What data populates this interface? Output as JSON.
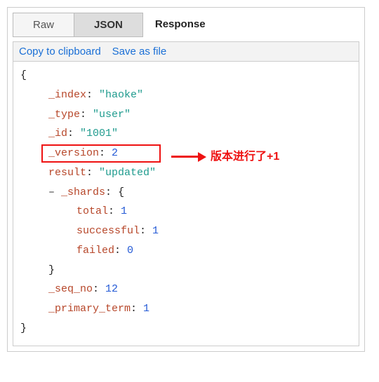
{
  "tabs": {
    "raw": "Raw",
    "json": "JSON",
    "response": "Response"
  },
  "actions": {
    "copy": "Copy to clipboard",
    "save": "Save as file"
  },
  "json": {
    "open": "{",
    "close": "}",
    "index_key": "_index",
    "index_val": "\"haoke\"",
    "type_key": "_type",
    "type_val": "\"user\"",
    "id_key": "_id",
    "id_val": "\"1001\"",
    "version_key": "_version",
    "version_val": "2",
    "result_key": "result",
    "result_val": "\"updated\"",
    "shards_key": "_shards",
    "shards_open": "{",
    "shards_close": "}",
    "total_key": "total",
    "total_val": "1",
    "successful_key": "successful",
    "successful_val": "1",
    "failed_key": "failed",
    "failed_val": "0",
    "seqno_key": "_seq_no",
    "seqno_val": "12",
    "primary_key": "_primary_term",
    "primary_val": "1",
    "colon": ": ",
    "toggle": "–"
  },
  "annotation": "版本进行了+1"
}
